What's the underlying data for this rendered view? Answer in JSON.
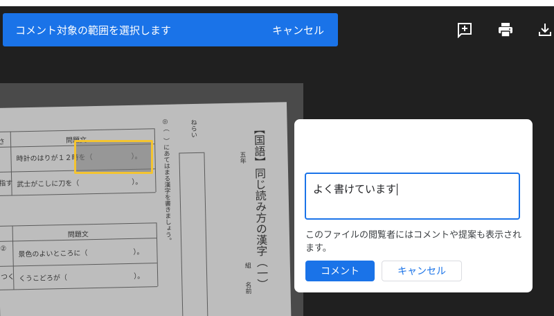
{
  "banner": {
    "message": "コメント対象の範囲を選択します",
    "cancel_label": "キャンセル"
  },
  "toolbar": {
    "icons": [
      "add-comment-icon",
      "print-icon",
      "download-icon"
    ]
  },
  "document": {
    "header_1": "問題文",
    "header_2": "問題文",
    "circle_2": "②",
    "row_1": "時計のはりが１２時を（",
    "row_1_end": "）。",
    "row_2": "武士がこしに刀を（",
    "row_2_end": "）。",
    "row_3": "景色のよいところに（",
    "row_3_end": "）。",
    "row_4": "くうこどろが（",
    "row_4_end": "）。",
    "left_1": "さ",
    "left_2": "指す",
    "left_3": "つく",
    "instruction": "◎（　）にあてはまる漢字を書きましょう。",
    "aim": "ねらい",
    "title": "【国語】同じ読み方の漢字（一）",
    "grade": "五年",
    "class_label": "組",
    "name_label": "名前"
  },
  "comment_card": {
    "text": "よく書けています",
    "hint": "このファイルの閲覧者にはコメントや提案も表示されます。",
    "submit_label": "コメント",
    "cancel_label": "キャンセル"
  },
  "colors": {
    "accent": "#1a73e8",
    "highlight_border": "#f4c430",
    "viewer_bg": "#202020"
  }
}
